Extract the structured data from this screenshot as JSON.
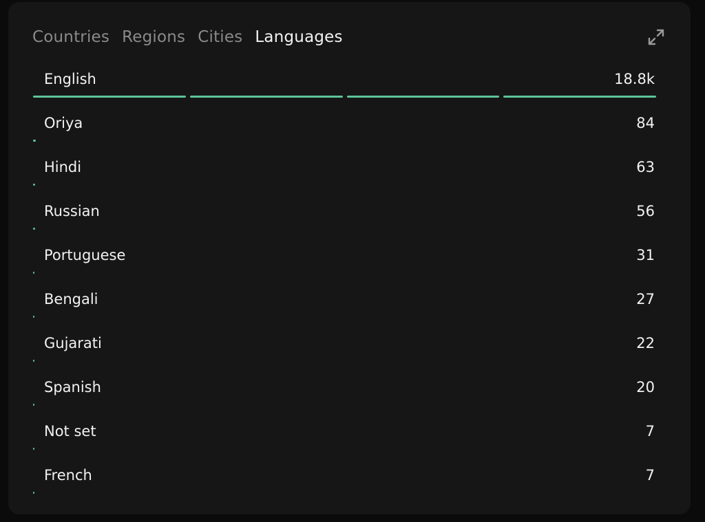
{
  "tabs": [
    {
      "label": "Countries",
      "active": false
    },
    {
      "label": "Regions",
      "active": false
    },
    {
      "label": "Cities",
      "active": false
    },
    {
      "label": "Languages",
      "active": true
    }
  ],
  "expand_icon": "expand-arrows-icon",
  "accent_color": "#5fc59a",
  "languages": [
    {
      "label": "English",
      "value": "18.8k",
      "count": 18800
    },
    {
      "label": "Oriya",
      "value": "84",
      "count": 84
    },
    {
      "label": "Hindi",
      "value": "63",
      "count": 63
    },
    {
      "label": "Russian",
      "value": "56",
      "count": 56
    },
    {
      "label": "Portuguese",
      "value": "31",
      "count": 31
    },
    {
      "label": "Bengali",
      "value": "27",
      "count": 27
    },
    {
      "label": "Gujarati",
      "value": "22",
      "count": 22
    },
    {
      "label": "Spanish",
      "value": "20",
      "count": 20
    },
    {
      "label": "Not set",
      "value": "7",
      "count": 7
    },
    {
      "label": "French",
      "value": "7",
      "count": 7
    }
  ]
}
